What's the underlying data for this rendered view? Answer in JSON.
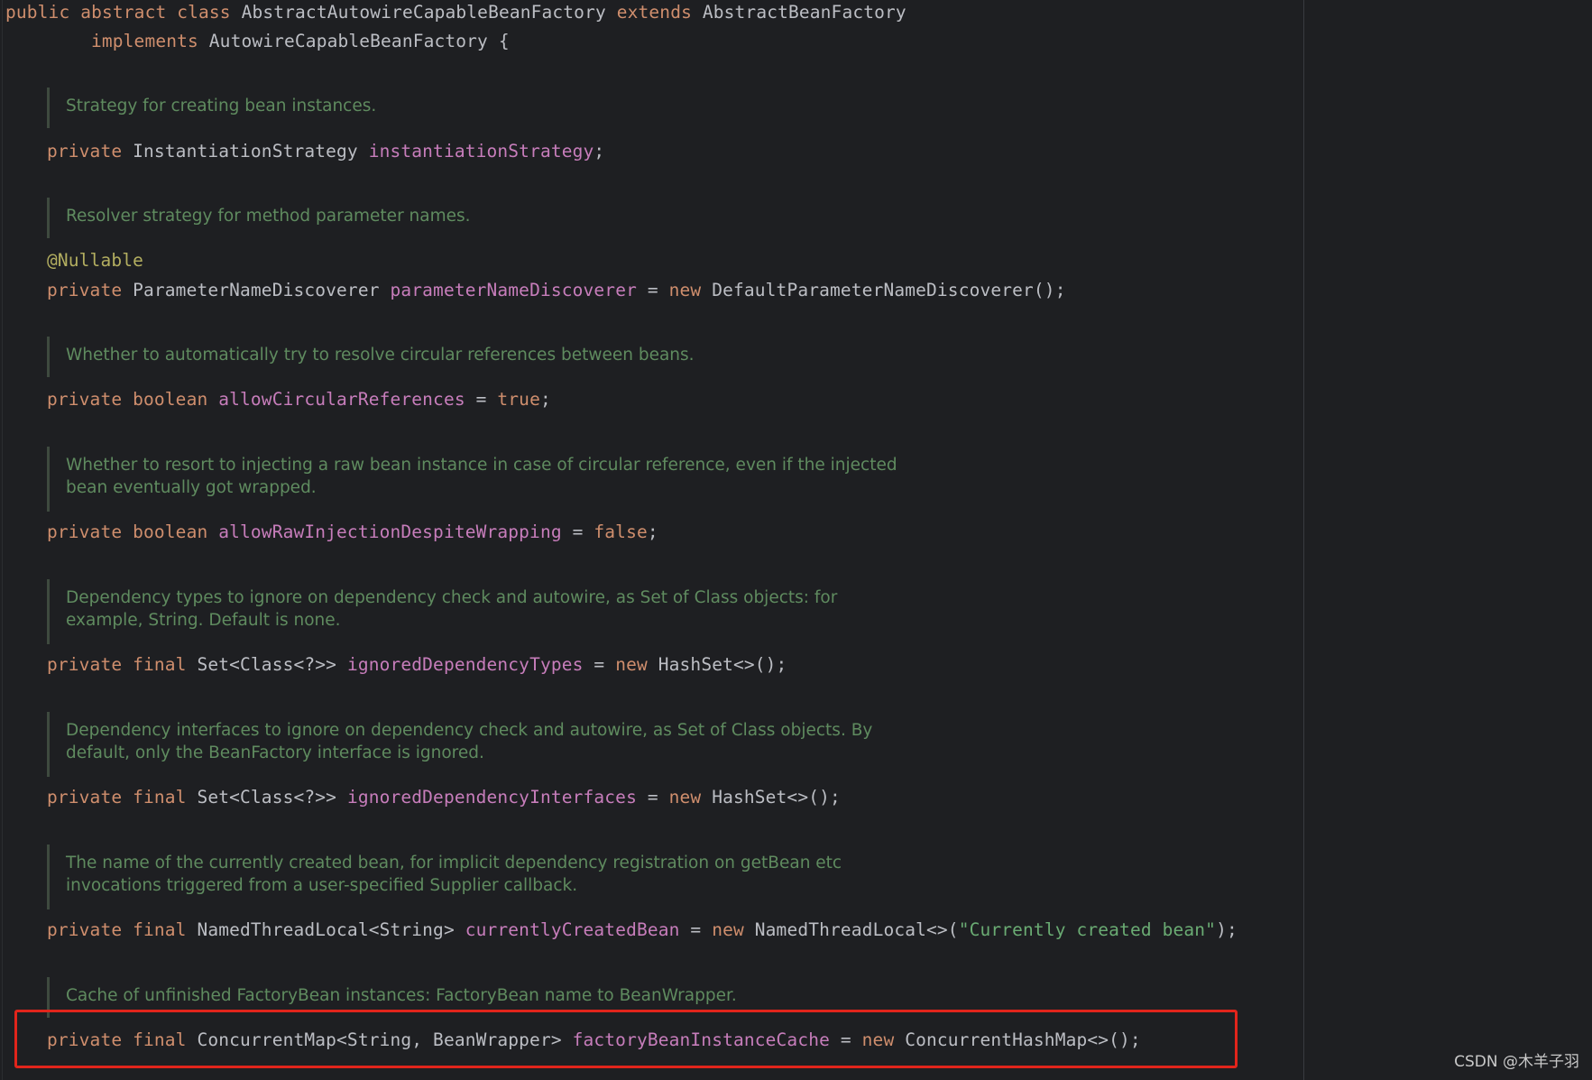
{
  "header": {
    "line1": {
      "kw1": "public",
      "kw2": "abstract",
      "kw3": "class",
      "class_name": "AbstractAutowireCapableBeanFactory",
      "kw4": "extends",
      "parent": "AbstractBeanFactory"
    },
    "line2": {
      "kw": "implements",
      "iface": "AutowireCapableBeanFactory {"
    }
  },
  "docs": [
    [
      "Strategy for creating bean instances."
    ],
    [
      "Resolver strategy for method parameter names."
    ],
    [
      "Whether to automatically try to resolve circular references between beans."
    ],
    [
      "Whether to resort to injecting a raw bean instance in case of circular reference, even if the injected",
      "bean eventually got wrapped."
    ],
    [
      "Dependency types to ignore on dependency check and autowire, as Set of Class objects: for",
      "example, String. Default is none."
    ],
    [
      "Dependency interfaces to ignore on dependency check and autowire, as Set of Class objects. By",
      "default, only the BeanFactory interface is ignored."
    ],
    [
      "The name of the currently created bean, for implicit dependency registration on getBean etc",
      "invocations triggered from a user-specified Supplier callback."
    ],
    [
      "Cache of unfinished FactoryBean instances: FactoryBean name to BeanWrapper."
    ]
  ],
  "fields": {
    "f1": {
      "kw": "private",
      "type": "InstantiationStrategy",
      "name": "instantiationStrategy",
      "rest": ";"
    },
    "f2_annotation": "@Nullable",
    "f2": {
      "kw": "private",
      "type": "ParameterNameDiscoverer",
      "name": "parameterNameDiscoverer",
      "eq": " = ",
      "new": "new",
      "rest": " DefaultParameterNameDiscoverer();"
    },
    "f3": {
      "kw": "private",
      "type": "boolean",
      "name": "allowCircularReferences",
      "eq": " = ",
      "val": "true",
      "rest": ";"
    },
    "f4": {
      "kw": "private",
      "type": "boolean",
      "name": "allowRawInjectionDespiteWrapping",
      "eq": " = ",
      "val": "false",
      "rest": ";"
    },
    "f5": {
      "kw": "private",
      "kw2": "final",
      "type": "Set<Class<?>>",
      "name": "ignoredDependencyTypes",
      "eq": " = ",
      "new": "new",
      "rest": " HashSet<>();"
    },
    "f6": {
      "kw": "private",
      "kw2": "final",
      "type": "Set<Class<?>>",
      "name": "ignoredDependencyInterfaces",
      "eq": " = ",
      "new": "new",
      "rest": " HashSet<>();"
    },
    "f7": {
      "kw": "private",
      "kw2": "final",
      "type": "NamedThreadLocal<String>",
      "name": "currentlyCreatedBean",
      "eq": " = ",
      "new": "new",
      "rest1": " NamedThreadLocal<>(",
      "str": "\"Currently created bean\"",
      "rest2": ");"
    },
    "f8": {
      "kw": "private",
      "kw2": "final",
      "type": "ConcurrentMap<String, BeanWrapper>",
      "name": "factoryBeanInstanceCache",
      "eq": " = ",
      "new": "new",
      "rest": " ConcurrentHashMap<>();"
    }
  },
  "watermark": "CSDN @木羊子羽",
  "colors": {
    "background": "#1e1f22",
    "keyword": "#cf8e6d",
    "field": "#c77dbb",
    "annotation": "#b3ae60",
    "string": "#6aab73",
    "doc": "#5f8b5f",
    "highlight": "#e1251b"
  }
}
